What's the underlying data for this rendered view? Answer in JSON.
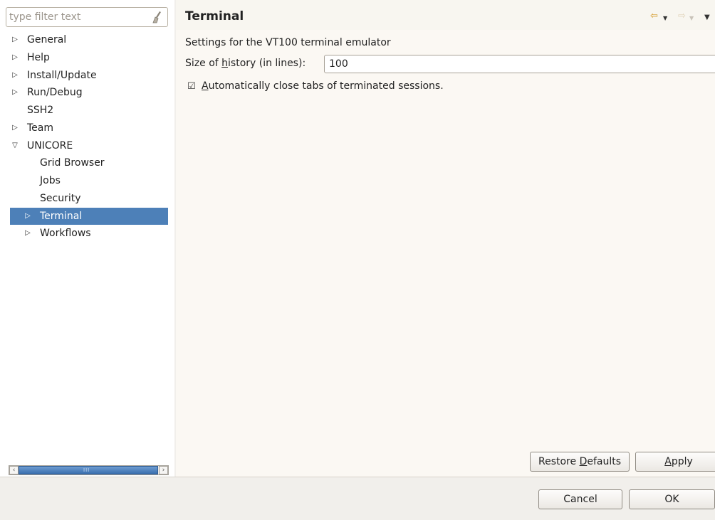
{
  "filter": {
    "placeholder": "type filter text"
  },
  "tree": {
    "items": [
      {
        "label": "General",
        "expandable": true,
        "expanded": false
      },
      {
        "label": "Help",
        "expandable": true,
        "expanded": false
      },
      {
        "label": "Install/Update",
        "expandable": true,
        "expanded": false
      },
      {
        "label": "Run/Debug",
        "expandable": true,
        "expanded": false
      },
      {
        "label": "SSH2",
        "expandable": false
      },
      {
        "label": "Team",
        "expandable": true,
        "expanded": false
      },
      {
        "label": "UNICORE",
        "expandable": true,
        "expanded": true
      },
      {
        "label": "Grid Browser",
        "expandable": false
      },
      {
        "label": "Jobs",
        "expandable": false
      },
      {
        "label": "Security",
        "expandable": false
      },
      {
        "label": "Terminal",
        "expandable": true,
        "expanded": false,
        "selected": true
      },
      {
        "label": "Workflows",
        "expandable": true,
        "expanded": false
      }
    ]
  },
  "page": {
    "title": "Terminal",
    "description": "Settings for the VT100 terminal emulator",
    "history_label": "Size of history (in lines):",
    "history_value": "100",
    "autoclose_label": "Automatically close tabs of terminated sessions.",
    "autoclose_checked": true
  },
  "buttons": {
    "restore_defaults": "Restore Defaults",
    "apply": "Apply",
    "cancel": "Cancel",
    "ok": "OK"
  },
  "icons": {
    "clear": "broom-icon",
    "back": "back-arrow-icon",
    "forward": "forward-arrow-icon",
    "menu": "view-menu-icon"
  },
  "colors": {
    "selection": "#4d80b8",
    "back_arrow": "#d49a29"
  }
}
